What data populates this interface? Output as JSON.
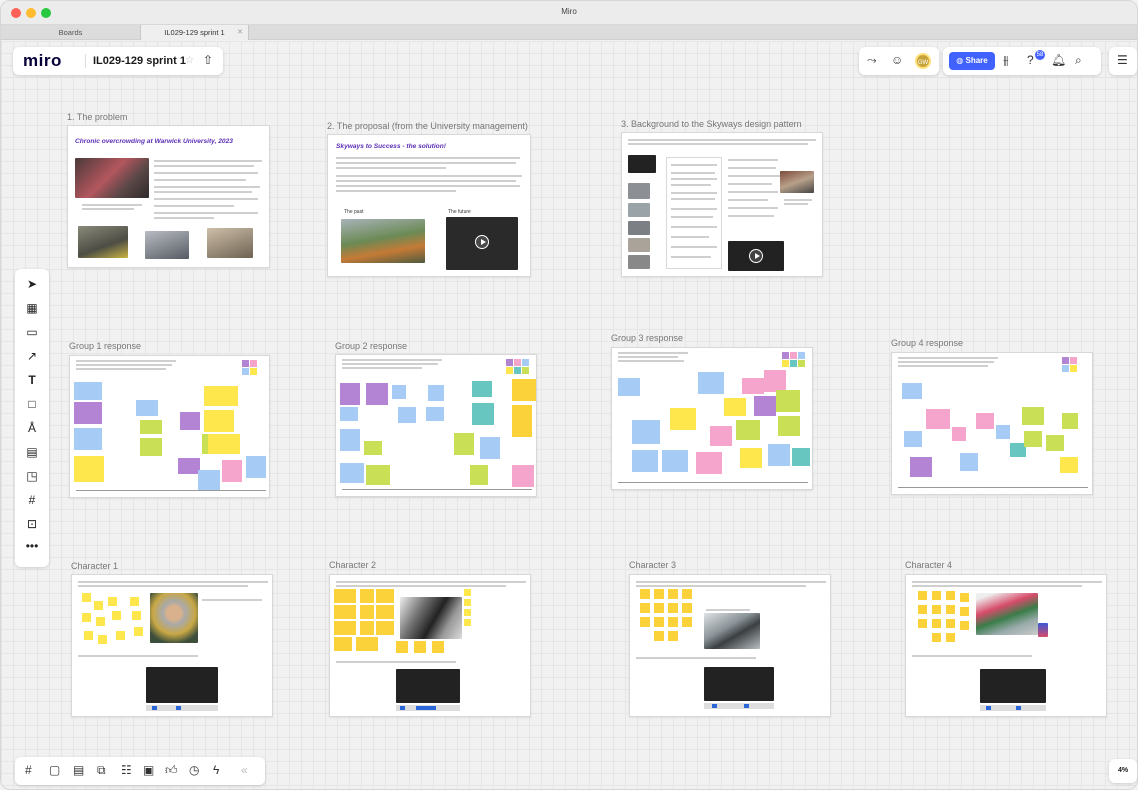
{
  "window": {
    "title": "Miro"
  },
  "tabs": [
    {
      "label": "Boards"
    },
    {
      "label": "IL029-129 sprint 1"
    }
  ],
  "header": {
    "logo": "miro",
    "board_name": "IL029-129 sprint 1",
    "avatar_initials": "GW",
    "share_label": "Share",
    "notifications_badge": "58"
  },
  "frames": {
    "problem": {
      "label": "1. The problem",
      "title": "Chronic overcrowding at Warwick University, 2023"
    },
    "proposal": {
      "label": "2. The proposal (from the University management)",
      "title": "Skyways to Success - the solution!",
      "caption_left": "The past",
      "caption_right": "The future"
    },
    "background": {
      "label": "3. Background to the Skyways design pattern"
    },
    "groups": [
      {
        "label": "Group 1 response"
      },
      {
        "label": "Group 2 response"
      },
      {
        "label": "Group 3 response"
      },
      {
        "label": "Group 4 response"
      }
    ],
    "characters": [
      {
        "label": "Character 1"
      },
      {
        "label": "Character 2"
      },
      {
        "label": "Character 3"
      },
      {
        "label": "Character 4"
      }
    ]
  },
  "zoom": {
    "level": "4%"
  },
  "colors": {
    "accent": "#4262ff",
    "sticky_yellow": "#fde74c",
    "sticky_orange": "#fbd23a",
    "sticky_blue": "#a6ccf5",
    "sticky_purple": "#b384d4",
    "sticky_green": "#c9df56",
    "sticky_pink": "#f5a5cc",
    "sticky_teal": "#67c6c0",
    "title_purple": "#5b2fb8"
  }
}
